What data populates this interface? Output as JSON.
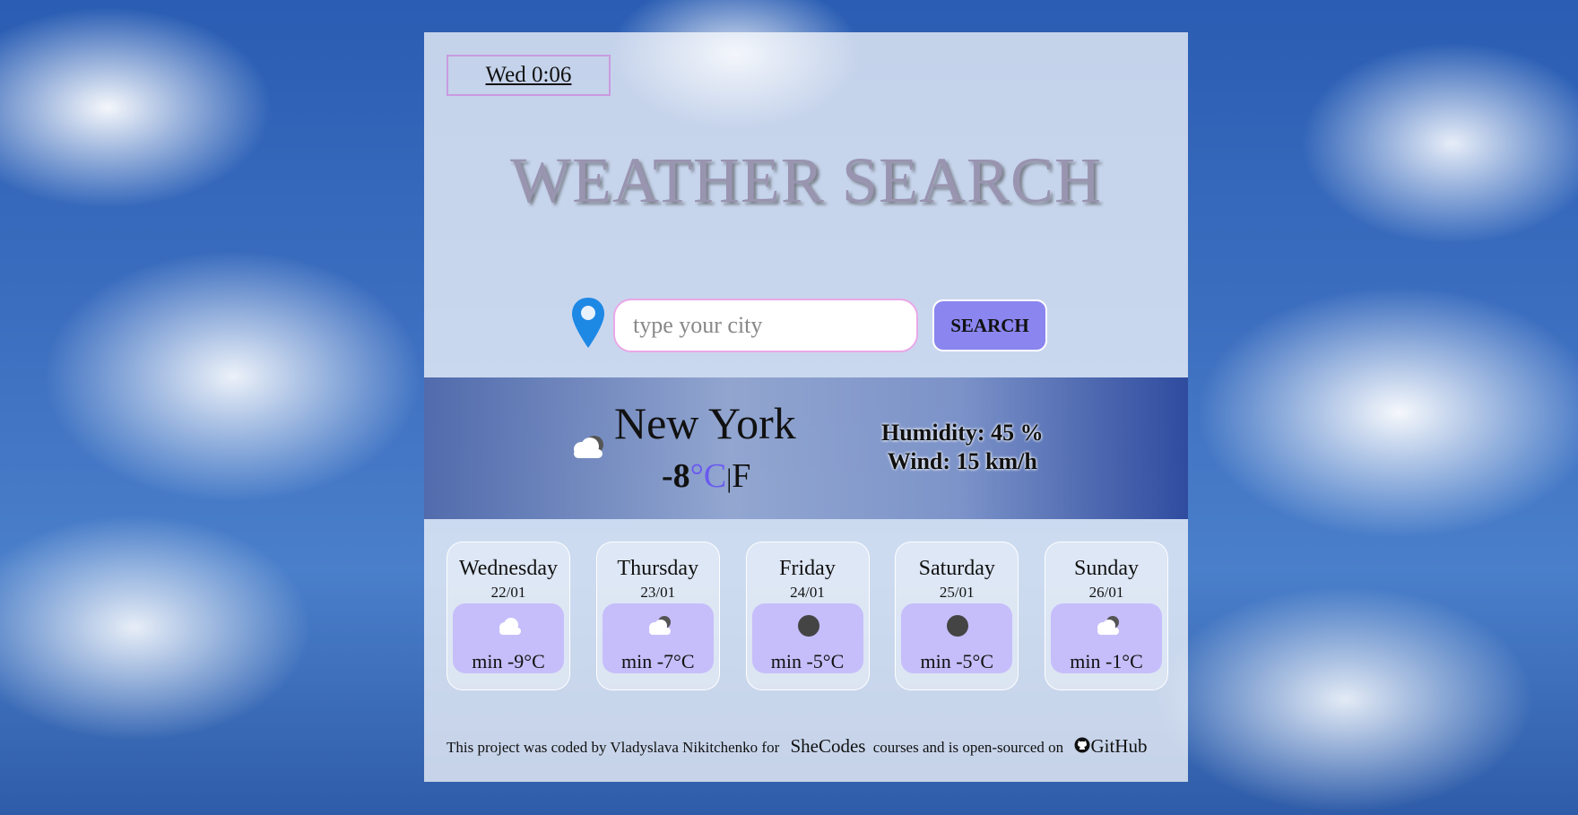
{
  "header": {
    "datetime": "Wed 0:06",
    "title": "WEATHER SEARCH"
  },
  "search": {
    "placeholder": "type your city",
    "button_label": "SEARCH"
  },
  "current": {
    "city": "New York",
    "temperature": "-8",
    "unit_celsius": "°C",
    "unit_separator": "|",
    "unit_fahrenheit": "F",
    "humidity": "Humidity: 45 %",
    "wind": "Wind: 15 km/h",
    "icon": "cloud-icon"
  },
  "forecast": [
    {
      "day": "Wednesday",
      "date": "22/01",
      "min": "min -9°C",
      "icon": "cloud-icon"
    },
    {
      "day": "Thursday",
      "date": "23/01",
      "min": "min -7°C",
      "icon": "cloudy-night-icon"
    },
    {
      "day": "Friday",
      "date": "24/01",
      "min": "min -5°C",
      "icon": "dark-circle-icon"
    },
    {
      "day": "Saturday",
      "date": "25/01",
      "min": "min -5°C",
      "icon": "dark-circle-icon"
    },
    {
      "day": "Sunday",
      "date": "26/01",
      "min": "min -1°C",
      "icon": "cloudy-night-icon"
    }
  ],
  "footer": {
    "text_before": "This project was coded by Vladyslava Nikitchenko for",
    "link_shecodes": "SheCodes",
    "text_middle": "courses and is open-sourced on",
    "link_github": "GitHub"
  },
  "colors": {
    "accent": "#8a85ef",
    "forecast_box": "#c6befa",
    "celsius": "#6a5af0",
    "pin": "#1e88e5"
  }
}
